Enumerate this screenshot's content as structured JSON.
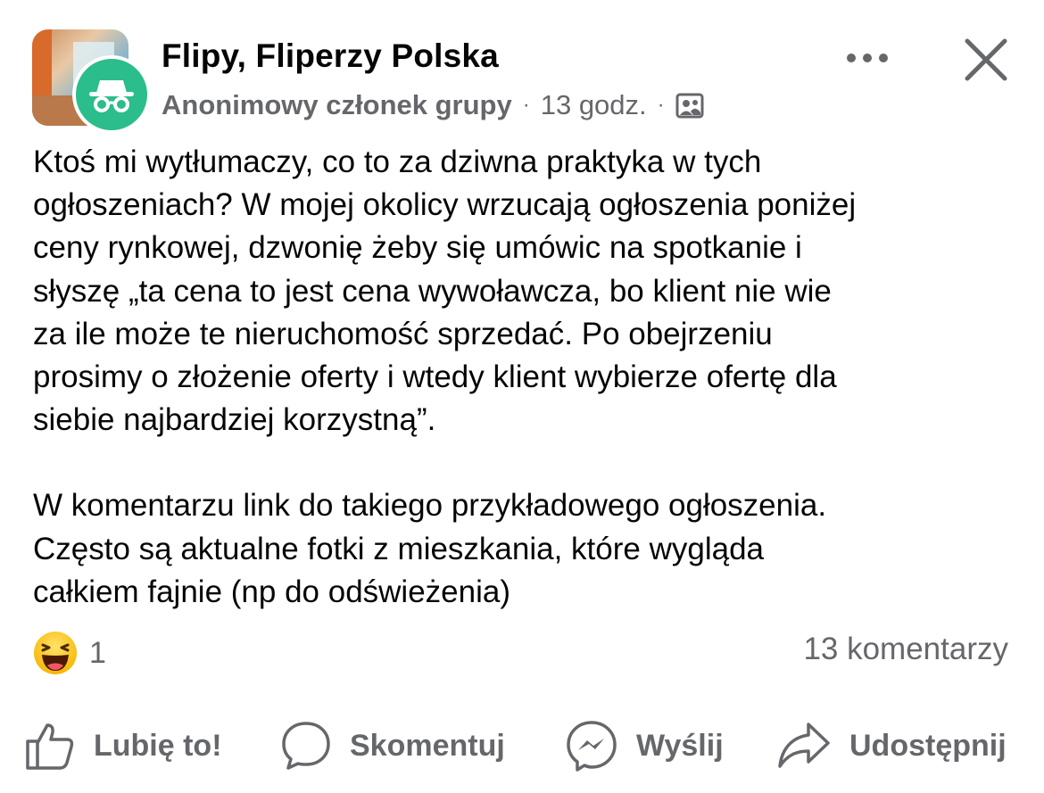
{
  "header": {
    "group_name": "Flipy, Fliperzy Polska",
    "author": "Anonimowy członek grupy",
    "separator": "·",
    "time": "13 godz.",
    "privacy_icon": "group-members-icon",
    "group_image": "group-cover-thumbnail",
    "avatar_icon": "incognito-icon",
    "more_icon": "more-horizontal-icon",
    "close_icon": "close-icon"
  },
  "post": {
    "paragraphs": [
      "Ktoś mi wytłumaczy, co to za dziwna praktyka w tych\nogłoszeniach? W mojej okolicy wrzucają ogłoszenia poniżej\nceny rynkowej, dzwonię żeby się umówic na spotkanie i\nsłyszę „ta cena to jest cena wywoławcza, bo klient nie wie\nza ile może te nieruchomość sprzedać. Po obejrzeniu\nprosimy o złożenie oferty i wtedy klient wybierze ofertę dla\nsiebie najbardziej korzystną”.",
      "W komentarzu link do takiego przykładowego ogłoszenia.\nCzęsto są aktualne fotki z mieszkania, które wygląda\ncałkiem fajnie (np do odświeżenia)"
    ]
  },
  "stats": {
    "reaction_icon": "haha-emoji-icon",
    "reaction_count": "1",
    "comments": "13 komentarzy"
  },
  "actions": [
    {
      "label": "Lubię to!",
      "icon": "thumbs-up-icon"
    },
    {
      "label": "Skomentuj",
      "icon": "comment-bubble-icon"
    },
    {
      "label": "Wyślij",
      "icon": "messenger-icon"
    },
    {
      "label": "Udostępnij",
      "icon": "share-arrow-icon"
    }
  ],
  "colors": {
    "text": "#050505",
    "secondary": "#65676b",
    "anon_green": "#2bbd8c"
  }
}
